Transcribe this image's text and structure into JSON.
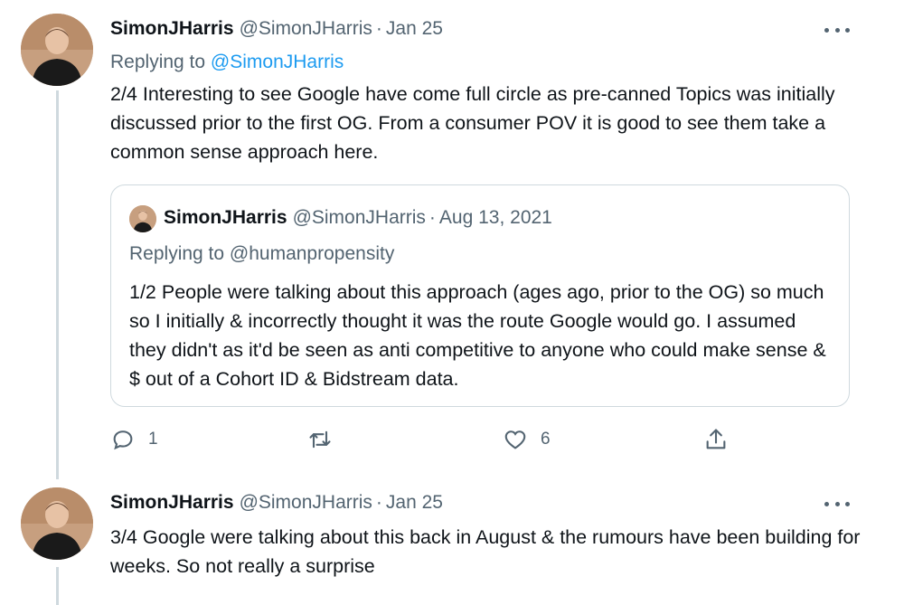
{
  "tweets": [
    {
      "name": "SimonJHarris",
      "handle": "@SimonJHarris",
      "separator": "·",
      "date": "Jan 25",
      "replying_label": "Replying to ",
      "replying_to": "@SimonJHarris",
      "text": "2/4 Interesting to see Google have come full circle as pre-canned Topics was initially discussed prior to the first OG. From a consumer POV it is good to see them take a common sense approach here.",
      "actions": {
        "reply_count": "1",
        "retweet_count": "",
        "like_count": "6"
      },
      "quote": {
        "name": "SimonJHarris",
        "handle": "@SimonJHarris",
        "separator": "·",
        "date": "Aug 13, 2021",
        "replying_label": "Replying to ",
        "replying_to": "@humanpropensity",
        "text": "1/2 People were talking about this approach (ages ago, prior to the OG) so much so I initially & incorrectly thought it was the route Google would go. I assumed they didn't as it'd be seen as anti competitive to anyone who could make sense & $ out of a Cohort ID & Bidstream data."
      }
    },
    {
      "name": "SimonJHarris",
      "handle": "@SimonJHarris",
      "separator": "·",
      "date": "Jan 25",
      "text": "3/4 Google were talking about this back in August & the rumours have been building for weeks. So not really a surprise"
    }
  ],
  "icons": {
    "more": "more-dots-icon",
    "reply": "reply-bubble-icon",
    "retweet": "retweet-icon",
    "like": "heart-icon",
    "share": "share-upload-icon"
  },
  "colors": {
    "link": "#1d9bf0",
    "secondary_text": "#536471",
    "border": "#cfd9de"
  }
}
